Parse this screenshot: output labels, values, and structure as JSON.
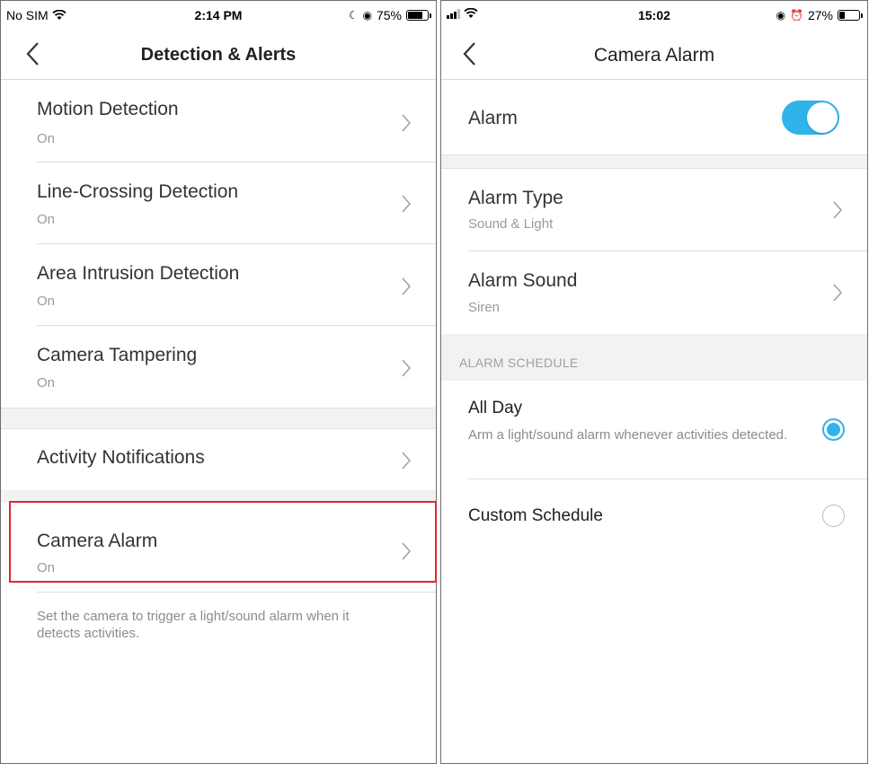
{
  "left_screen": {
    "status": {
      "carrier": "No SIM",
      "time": "2:14 PM",
      "battery_percent": "75%",
      "battery_level": 0.75
    },
    "nav": {
      "title": "Detection & Alerts"
    },
    "rows": [
      {
        "label": "Motion Detection",
        "value": "On"
      },
      {
        "label": "Line-Crossing Detection",
        "value": "On"
      },
      {
        "label": "Area Intrusion Detection",
        "value": "On"
      },
      {
        "label": "Camera Tampering",
        "value": "On"
      }
    ],
    "activity": {
      "label": "Activity Notifications"
    },
    "camera_alarm": {
      "label": "Camera Alarm",
      "value": "On"
    },
    "footnote": {
      "text": "Set the camera to trigger a light/sound alarm when it detects activities."
    },
    "highlight_color": "#e0262d"
  },
  "right_screen": {
    "status": {
      "time": "15:02",
      "battery_percent": "27%",
      "battery_level": 0.27
    },
    "nav": {
      "title": "Camera Alarm"
    },
    "alarm": {
      "label": "Alarm",
      "enabled": true
    },
    "alarm_type": {
      "label": "Alarm Type",
      "value": "Sound & Light"
    },
    "alarm_sound": {
      "label": "Alarm Sound",
      "value": "Siren"
    },
    "schedule_header": "ALARM SCHEDULE",
    "all_day": {
      "label": "All Day",
      "description": "Arm a light/sound alarm whenever activities detected.",
      "selected": true
    },
    "custom": {
      "label": "Custom Schedule",
      "selected": false
    },
    "accent_color": "#2eb4ea"
  }
}
